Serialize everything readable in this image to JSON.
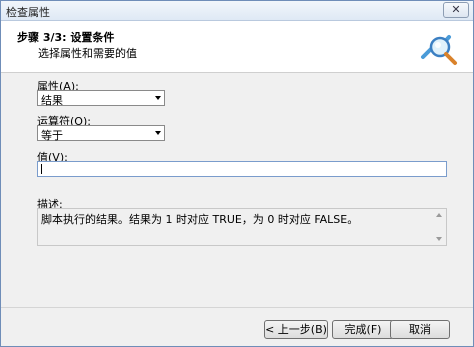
{
  "window": {
    "title": "检查属性",
    "close_glyph": "✕"
  },
  "header": {
    "step_title": "步骤 3/3: 设置条件",
    "subtitle": "选择属性和需要的值",
    "icon": "magnifier-check-icon"
  },
  "form": {
    "attribute": {
      "label_pre": "属性(",
      "mnemonic": "A",
      "label_post": "):",
      "value": "结果"
    },
    "operator": {
      "label_pre": "运算符(",
      "mnemonic": "O",
      "label_post": "):",
      "value": "等于"
    },
    "value_field": {
      "label_pre": "值(",
      "mnemonic": "V",
      "label_post": "):",
      "value": ""
    },
    "description": {
      "label": "描述:",
      "text": "脚本执行的结果。结果为 1 时对应 TRUE，为 0 时对应 FALSE。"
    }
  },
  "buttons": {
    "back": "< 上一步(B)",
    "finish": "完成(F)",
    "cancel": "取消"
  }
}
